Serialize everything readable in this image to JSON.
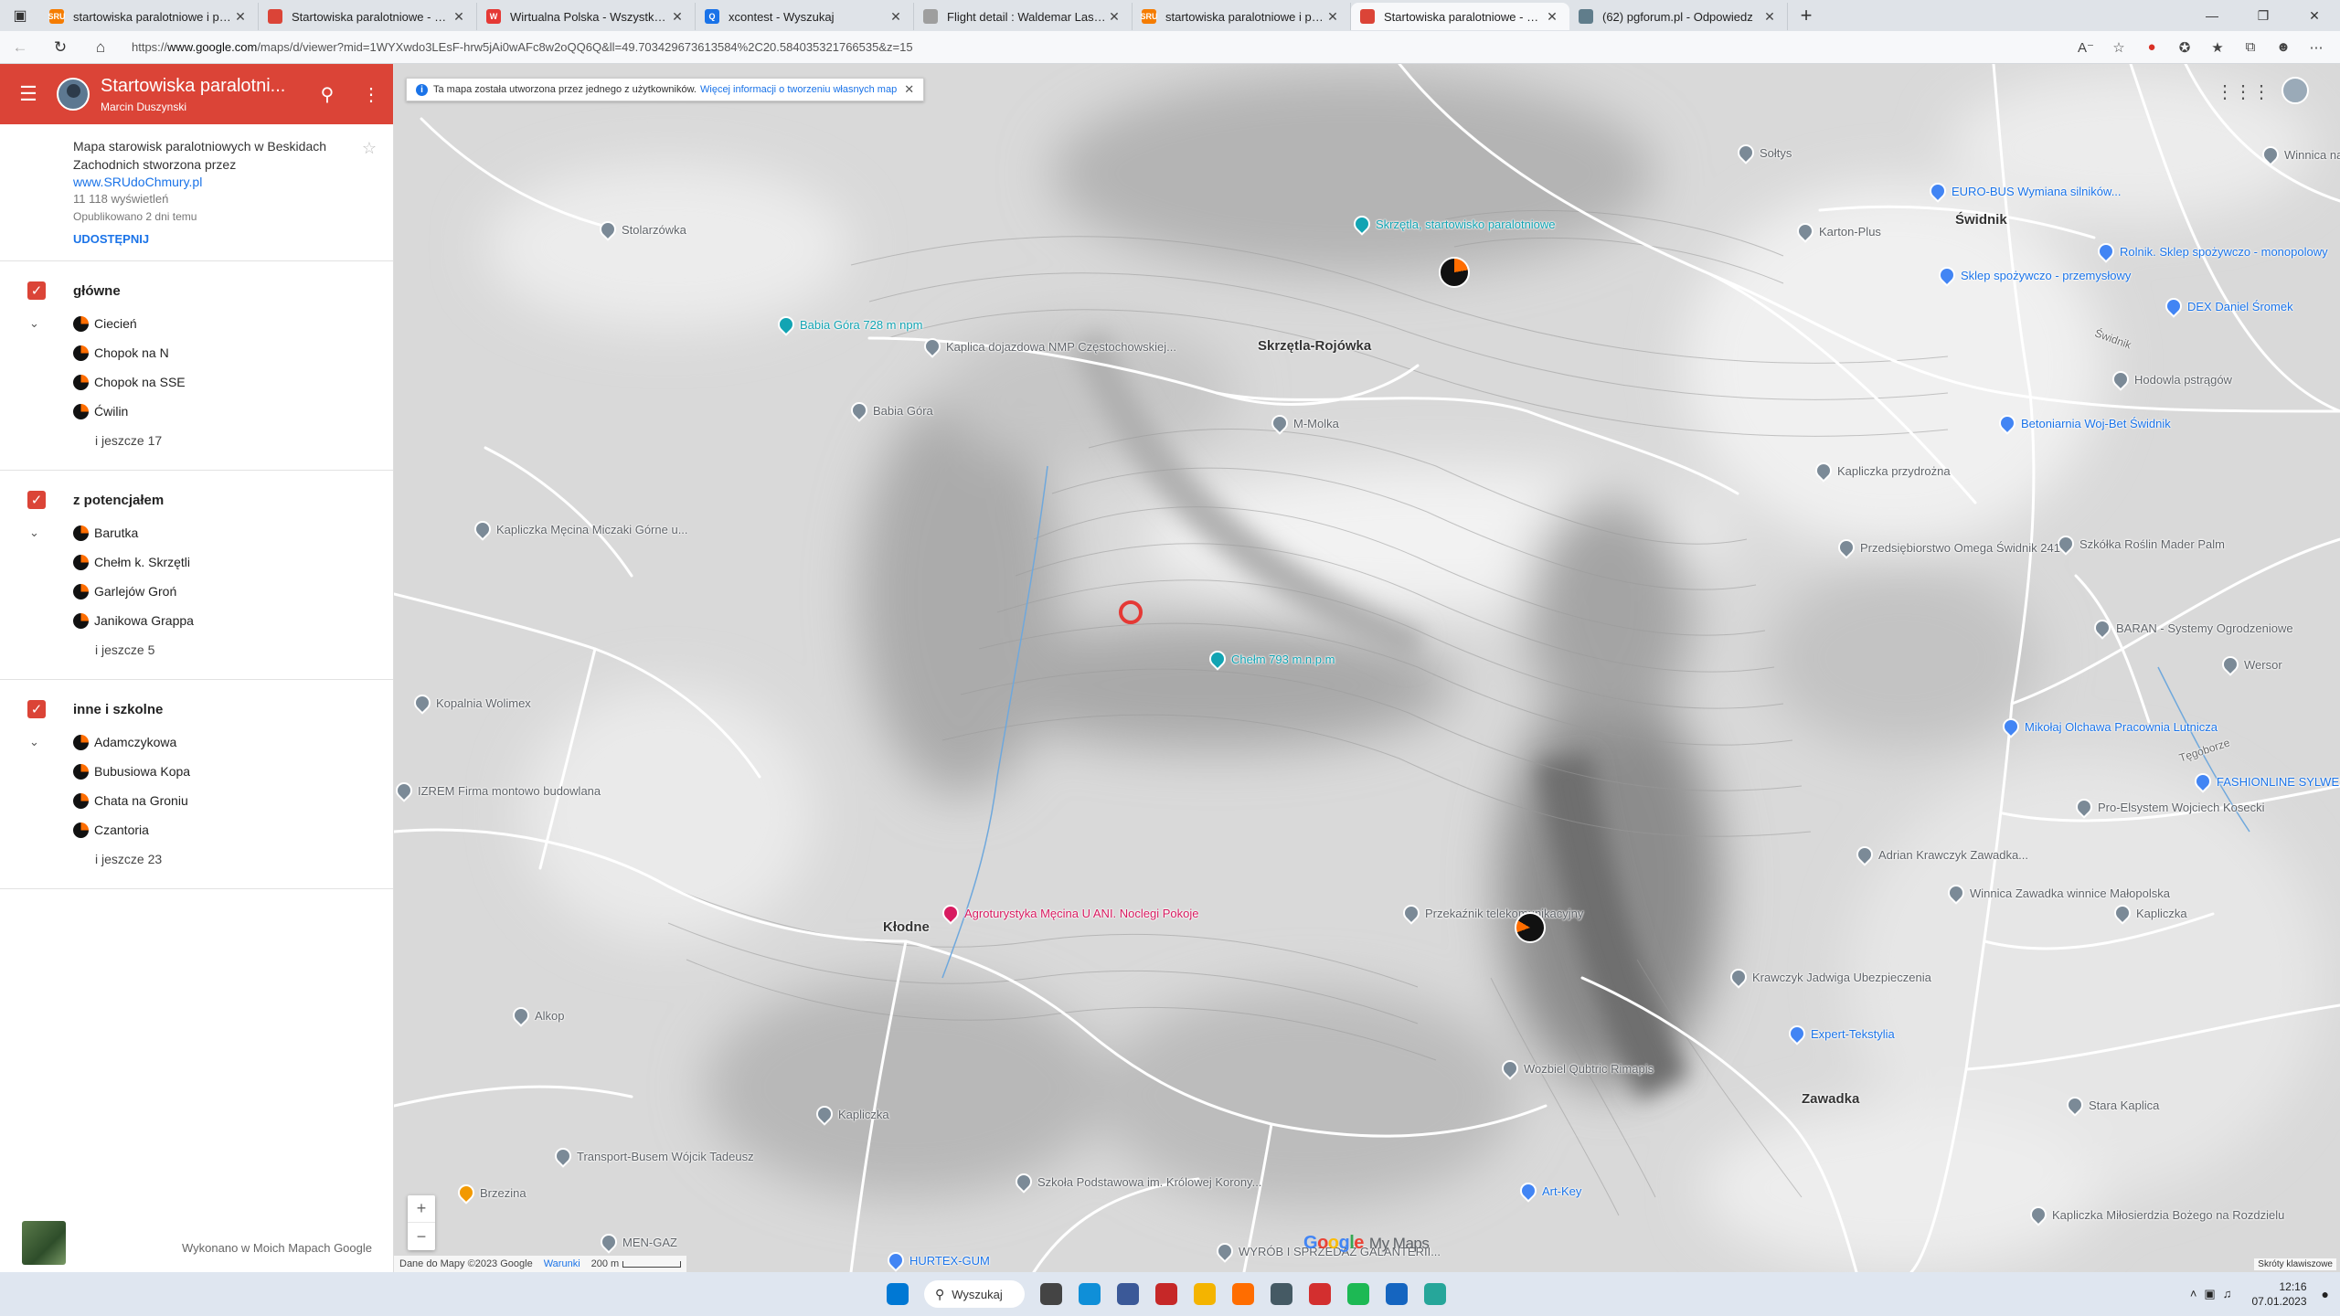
{
  "browser": {
    "tabs": [
      {
        "title": "startowiska paralotniowe i progno",
        "favicon_color": "#f57c00",
        "favicon_text": "SRU",
        "active": false
      },
      {
        "title": "Startowiska paralotniowe - Beskid",
        "favicon_color": "#db4437",
        "favicon_text": "",
        "active": false
      },
      {
        "title": "Wirtualna Polska - Wszystko co wa",
        "favicon_color": "#e53935",
        "favicon_text": "W",
        "active": false
      },
      {
        "title": "xcontest - Wyszukaj",
        "favicon_color": "#1a73e8",
        "favicon_text": "Q",
        "active": false
      },
      {
        "title": "Flight detail : Waldemar Laskows",
        "favicon_color": "#9e9e9e",
        "favicon_text": "",
        "active": false
      },
      {
        "title": "startowiska paralotniowe i progno",
        "favicon_color": "#f57c00",
        "favicon_text": "SRU",
        "active": false
      },
      {
        "title": "Startowiska paralotniowe - Beskid",
        "favicon_color": "#db4437",
        "favicon_text": "",
        "active": true
      },
      {
        "title": "(62) pgforum.pl - Odpowiedz",
        "favicon_color": "#607d8b",
        "favicon_text": "",
        "active": false
      }
    ],
    "url_prefix": "https://",
    "url_domain": "www.google.com",
    "url_rest": "/maps/d/viewer?mid=1WYXwdo3LEsF-hrw5jAi0wAFc8w2oQQ6Q&ll=49.703429673613584%2C20.584035321766535&z=15"
  },
  "sidebar": {
    "map_title": "Startowiska paralotni...",
    "owner": "Marcin Duszynski",
    "description": "Mapa starowisk paralotniowych w Beskidach Zachodnich stworzona przez",
    "link": "www.SRUdoChmury.pl",
    "views": "11 118 wyświetleń",
    "published": "Opublikowano 2 dni temu",
    "share": "UDOSTĘPNIJ",
    "layers": [
      {
        "name": "główne",
        "items": [
          "Ciecień",
          "Chopok na N",
          "Chopok na SSE",
          "Ćwilin"
        ],
        "more": "i jeszcze 17"
      },
      {
        "name": "z potencjałem",
        "items": [
          "Barutka",
          "Chełm k. Skrzętli",
          "Garlejów Groń",
          "Janikowa Grappa"
        ],
        "more": "i jeszcze 5"
      },
      {
        "name": "inne i szkolne",
        "items": [
          "Adamczykowa",
          "Bubusiowa Kopa",
          "Chata na Groniu",
          "Czantoria"
        ],
        "more": "i jeszcze 23"
      }
    ],
    "footer": "Wykonano w Moich Mapach Google"
  },
  "map": {
    "notice": "Ta mapa została utworzona przez jednego z użytkowników.",
    "notice_link": "Więcej informacji o tworzeniu własnych map",
    "pois": {
      "soltys": "Sołtys",
      "eurobus": "EURO-BUS Wymiana silników...",
      "winnica_dziole": "Winnica na Dziole",
      "karton_plus": "Karton-Plus",
      "swidnik": "Świdnik",
      "rolnik": "Rolnik. Sklep spożywczo - monopolowy",
      "sklep_spozywczo": "Sklep spożywczo - przemysłowy",
      "dex": "DEX Daniel Śromek",
      "stolarzowka": "Stolarzówka",
      "skrzetla_start": "Skrzętla, startowisko paralotniowe",
      "babia_gora_peak": "Babia Góra 728 m npm",
      "kaplica_nmp": "Kaplica dojazdowa NMP Częstochowskiej...",
      "skrzetla_rojowka": "Skrzętla-Rojówka",
      "hodowla": "Hodowla pstrągów",
      "babia_gora": "Babia Góra",
      "m_molka": "M-Molka",
      "betoniarnia": "Betoniarnia Woj-Bet Świdnik",
      "kapliczka_przydrozna": "Kapliczka przydrożna",
      "kapliczka_mecina": "Kapliczka Męcina Miczaki Górne u...",
      "omega": "Przedsiębiorstwo Omega Świdnik 241",
      "szkolka": "Szkółka Roślin Mader Palm",
      "chelm_peak": "Chełm 793 m.n.p.m",
      "baran": "BARAN - Systemy Ogrodzeniowe",
      "wersor": "Wersor",
      "kopalnia": "Kopalnia Wolimex",
      "mikolaj": "Mikołaj Olchawa Pracownia Lutnicza",
      "fashion": "FASHIONLINE SYLWESTER...",
      "izrem": "IZREM Firma montowo budowlana",
      "pro_elsystem": "Pro-Elsystem Wojciech Kosecki",
      "adrian": "Adrian Krawczyk Zawadka...",
      "winnica_zawadka": "Winnica Zawadka winnice Małopolska",
      "przekaznik": "Przekaźnik telekomunikacyjny",
      "agroturystyka": "Agroturystyka Męcina U ANI. Noclegi Pokoje",
      "klodne": "Kłodne",
      "kapliczka_right": "Kapliczka",
      "krawczyk_jadwiga": "Krawczyk Jadwiga Ubezpieczenia",
      "alkop": "Alkop",
      "expert": "Expert-Tekstylia",
      "wozbiel": "Wozbiel Qubtric Rimapis",
      "kapliczka_bottom": "Kapliczka",
      "zawadka": "Zawadka",
      "stara_kaplica": "Stara Kaplica",
      "transport": "Transport-Busem Wójcik Tadeusz",
      "brzezina": "Brzezina",
      "szkola": "Szkoła Podstawowa im. Królowej Korony...",
      "art_key": "Art-Key",
      "kapliczka_milosierdzia": "Kapliczka Miłosierdzia Bożego na Rozdzielu",
      "men_gaz": "MEN-GAZ",
      "hurtex": "HURTEX-GUM",
      "wyrob": "WYRÓB I SPRZEDAŻ GALANTERII...",
      "road_swidnik": "Świdnik",
      "road_tegoborze": "Tęgoborze"
    },
    "google_logo": [
      "G",
      "o",
      "o",
      "g",
      "l",
      "e"
    ],
    "my_maps": "My Maps",
    "attribution": "Dane do Mapy ©2023 Google",
    "terms": "Warunki",
    "scale": "200 m",
    "shortcuts": "Skróty klawiszowe"
  },
  "taskbar": {
    "search": "Wyszukaj",
    "time": "12:16",
    "date": "07.01.2023",
    "apps": [
      "start-icon",
      "taskview-icon",
      "edge-icon",
      "chat-icon",
      "office-icon",
      "explorer-icon",
      "firefox-icon",
      "calculator-icon",
      "acrobat-icon",
      "spotify-icon",
      "se-icon",
      "globe-icon"
    ],
    "app_colors": [
      "#0078d4",
      "#444444",
      "#0f8fd8",
      "#3b5998",
      "#c62828",
      "#f4b400",
      "#ff6d00",
      "#455a64",
      "#d32f2f",
      "#1db954",
      "#1565c0",
      "#26a69a"
    ]
  }
}
